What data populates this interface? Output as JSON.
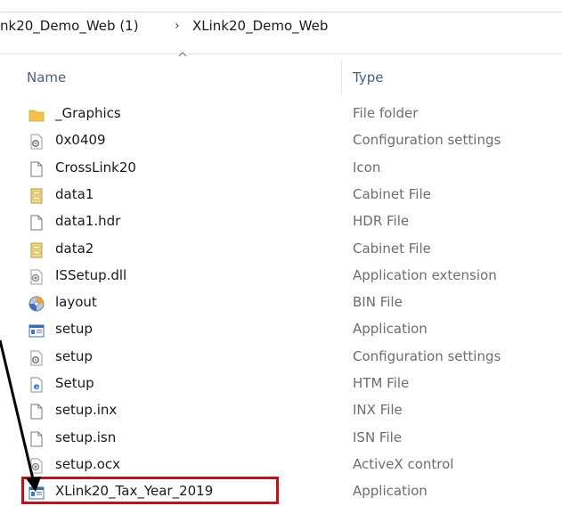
{
  "breadcrumb": {
    "parent": "nk20_Demo_Web (1)",
    "separator": "›",
    "current": "XLink20_Demo_Web"
  },
  "columns": {
    "name": "Name",
    "type": "Type"
  },
  "files": [
    {
      "name": "_Graphics",
      "type": "File folder",
      "icon": "folder-icon"
    },
    {
      "name": "0x0409",
      "type": "Configuration settings",
      "icon": "settings-file-icon"
    },
    {
      "name": "CrossLink20",
      "type": "Icon",
      "icon": "blank-file-icon"
    },
    {
      "name": "data1",
      "type": "Cabinet File",
      "icon": "cabinet-file-icon"
    },
    {
      "name": "data1.hdr",
      "type": "HDR File",
      "icon": "blank-file-icon"
    },
    {
      "name": "data2",
      "type": "Cabinet File",
      "icon": "cabinet-file-icon"
    },
    {
      "name": "ISSetup.dll",
      "type": "Application extension",
      "icon": "dll-file-icon"
    },
    {
      "name": "layout",
      "type": "BIN File",
      "icon": "disc-icon"
    },
    {
      "name": "setup",
      "type": "Application",
      "icon": "application-icon"
    },
    {
      "name": "setup",
      "type": "Configuration settings",
      "icon": "settings-file-icon"
    },
    {
      "name": "Setup",
      "type": "HTM File",
      "icon": "edge-file-icon"
    },
    {
      "name": "setup.inx",
      "type": "INX File",
      "icon": "blank-file-icon"
    },
    {
      "name": "setup.isn",
      "type": "ISN File",
      "icon": "blank-file-icon"
    },
    {
      "name": "setup.ocx",
      "type": "ActiveX control",
      "icon": "dll-file-icon"
    },
    {
      "name": "XLink20_Tax_Year_2019",
      "type": "Application",
      "icon": "application-icon"
    }
  ],
  "colors": {
    "highlight_border": "#b0191e",
    "header_text": "#4c607a",
    "type_text": "#6d6d6d"
  }
}
